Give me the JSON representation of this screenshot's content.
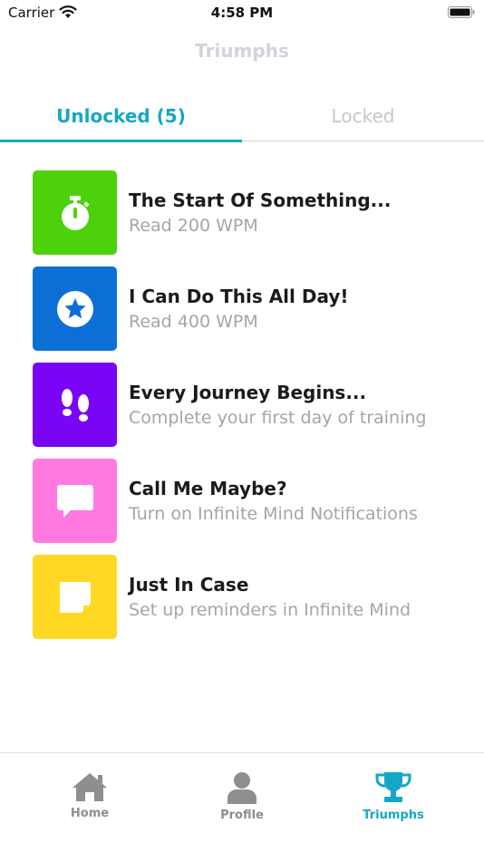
{
  "status_bar": {
    "carrier": "Carrier",
    "time": "4:58 PM"
  },
  "nav": {
    "title": "Triumphs"
  },
  "tabs": [
    {
      "label": "Unlocked (5)",
      "selected": true
    },
    {
      "label": "Locked",
      "selected": false
    }
  ],
  "colors": {
    "accent": "#15a7c7",
    "green": "#4dd10b",
    "blue": "#0b6fd6",
    "purple": "#7a05f5",
    "pink": "#ff79e0",
    "yellow": "#ffd823"
  },
  "achievements": [
    {
      "title": "The Start Of Something...",
      "desc": "Read 200 WPM",
      "icon": "stopwatch-icon",
      "color": "#4dd10b"
    },
    {
      "title": "I Can Do This All Day!",
      "desc": "Read 400 WPM",
      "icon": "star-badge-icon",
      "color": "#0b6fd6"
    },
    {
      "title": "Every Journey Begins...",
      "desc": "Complete your first day of training",
      "icon": "footprints-icon",
      "color": "#7a05f5"
    },
    {
      "title": "Call Me Maybe?",
      "desc": "Turn on Infinite Mind Notifications",
      "icon": "chat-bubble-icon",
      "color": "#ff79e0"
    },
    {
      "title": "Just In Case",
      "desc": "Set up reminders in Infinite Mind",
      "icon": "sticky-note-icon",
      "color": "#ffd823"
    }
  ],
  "tabbar": [
    {
      "label": "Home",
      "icon": "home-icon",
      "selected": false
    },
    {
      "label": "Profile",
      "icon": "person-icon",
      "selected": false
    },
    {
      "label": "Triumphs",
      "icon": "trophy-icon",
      "selected": true
    }
  ]
}
